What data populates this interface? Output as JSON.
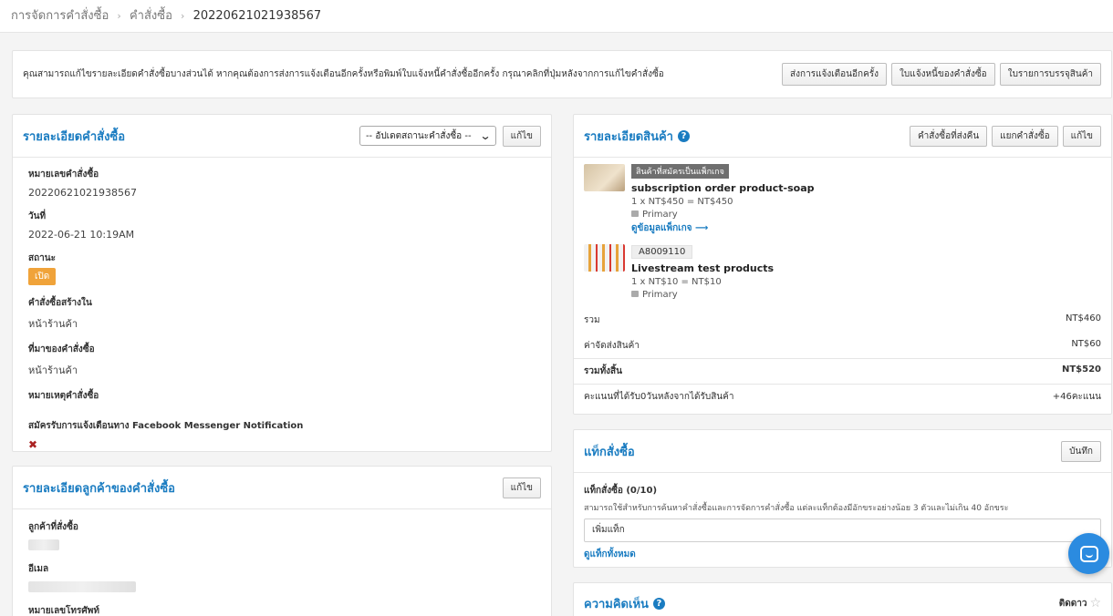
{
  "breadcrumb": {
    "items": [
      "การจัดการคำสั่งซื้อ",
      "คำสั่งซื้อ"
    ],
    "current": "20220621021938567",
    "separator": "›"
  },
  "notice": {
    "text": "คุณสามารถแก้ไขรายละเอียดคำสั่งซื้อบางส่วนได้ หากคุณต้องการส่งการแจ้งเตือนอีกครั้งหรือพิมพ์ใบแจ้งหนี้คำสั่งซื้ออีกครั้ง กรุณาคลิกที่ปุ่มหลังจากการแก้ไขคำสั่งซื้อ",
    "buttons": [
      "ส่งการแจ้งเตือนอีกครั้ง",
      "ใบแจ้งหนี้ของคำสั่งซื้อ",
      "ใบรายการบรรจุสินค้า"
    ]
  },
  "order_details": {
    "title": "รายละเอียดคำสั่งซื้อ",
    "status_select": "-- อัปเดตสถานะคำสั่งซื้อ --",
    "edit_label": "แก้ไข",
    "fields": [
      {
        "label": "หมายเลขคำสั่งซื้อ",
        "value": "20220621021938567"
      },
      {
        "label": "วันที่",
        "value": "2022-06-21 10:19AM"
      },
      {
        "label": "สถานะ",
        "value": "เปิด"
      },
      {
        "label": "คำสั่งซื้อสร้างใน",
        "value": "หน้าร้านค้า"
      },
      {
        "label": "ที่มาของคำสั่งซื้อ",
        "value": "หน้าร้านค้า"
      },
      {
        "label": "หมายเหตุคำสั่งซื้อ",
        "value": ""
      },
      {
        "label": "สมัครรับการแจ้งเตือนทาง Facebook Messenger Notification",
        "value": "✖"
      }
    ],
    "status_color": "#f0a33a"
  },
  "customer_details": {
    "title": "รายละเอียดลูกค้าของคำสั่งซื้อ",
    "edit_label": "แก้ไข",
    "fields": [
      {
        "label": "ลูกค้าที่สั่งซื้อ"
      },
      {
        "label": "อีเมล"
      },
      {
        "label": "หมายเลขโทรศัพท์"
      }
    ]
  },
  "product_details": {
    "title": "รายละเอียดสินค้า",
    "buttons": [
      "คำสั่งซื้อที่ส่งคืน",
      "แยกคำสั่งซื้อ",
      "แก้ไข"
    ],
    "items": [
      {
        "badge": "สินค้าที่สมัครเป็นแพ็กเกจ",
        "name": "subscription order product-soap",
        "price_line": "1 x NT$450 = NT$450",
        "location": "Primary",
        "link": "ดูข้อมูลแพ็กเกจ ⟶"
      },
      {
        "badge": "A8009110",
        "name": "Livestream test products",
        "price_line": "1 x NT$10 = NT$10",
        "location": "Primary"
      }
    ],
    "summary": {
      "subtotal_label": "รวม",
      "subtotal": "NT$460",
      "shipping_label": "ค่าจัดส่งสินค้า",
      "shipping": "NT$60",
      "total_label": "รวมทั้งสิ้น",
      "total": "NT$520",
      "points_label": "คะแนนที่ได้รับ0วันหลังจากได้รับสินค้า",
      "points": "+46คะแนน"
    }
  },
  "order_tags": {
    "title": "แท็กสั่งซื้อ",
    "save_label": "บันทึก",
    "field_label": "แท็กสั่งซื้อ (0/10)",
    "hint": "สามารถใช้สำหรับการค้นหาคำสั่งซื้อและการจัดการคำสั่งซื้อ แต่ละแท็กต้องมีอักขระอย่างน้อย 3 ตัวและไม่เกิน 40 อักขระ",
    "input_value": "เพิ่มแท็ก",
    "view_all": "ดูแท็กทั้งหมด"
  },
  "comments": {
    "title": "ความคิดเห็น",
    "follow_label": "ติดดาว"
  },
  "colors": {
    "accent": "#1a7cc1",
    "chat_button": "#2b8be0"
  }
}
